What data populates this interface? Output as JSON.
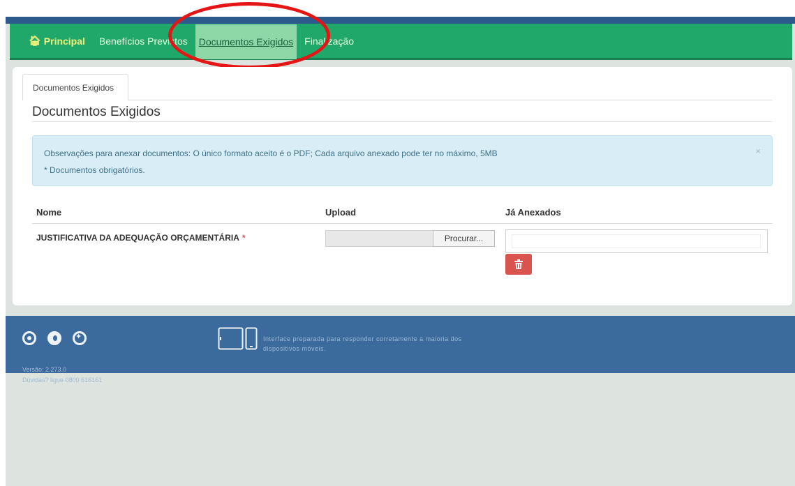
{
  "nav": {
    "home": "Principal",
    "items": [
      "Benefícios Previstos",
      "Documentos Exigidos",
      "Finalização"
    ],
    "active": "Documentos Exigidos"
  },
  "tab": {
    "label": "Documentos Exigidos"
  },
  "section": {
    "title": "Documentos Exigidos"
  },
  "alert": {
    "line1": "Observações para anexar documentos: O único formato aceito é o PDF; Cada arquivo anexado pode ter no máximo, 5MB",
    "line2": "* Documentos obrigatórios.",
    "close": "×"
  },
  "table": {
    "headers": {
      "name": "Nome",
      "upload": "Upload",
      "attached": "Já Anexados"
    },
    "rows": [
      {
        "name": "JUSTIFICATIVA DA ADEQUAÇÃO ORÇAMENTÁRIA",
        "required_mark": "*",
        "browse_label": "Procurar..."
      }
    ]
  },
  "footer": {
    "version": "Versão: 2.273.0",
    "help": "Dúvidas? ligue 0800 616161",
    "responsive_note": "Interface preparada para responder corretamente a maioria dos dispositivos móveis."
  },
  "colors": {
    "navbar": "#20a86a",
    "nav_active": "#8ed8a8",
    "home_link": "#f2f27a",
    "footer": "#3a6b9c",
    "alert_bg": "#d8edf6",
    "delete_button": "#d9534f",
    "highlight_ellipse": "#e51515"
  },
  "icons": [
    "home-icon",
    "close-icon",
    "trash-icon",
    "chrome-icon",
    "firefox-icon",
    "safari-icon",
    "tablet-phone-icon"
  ]
}
